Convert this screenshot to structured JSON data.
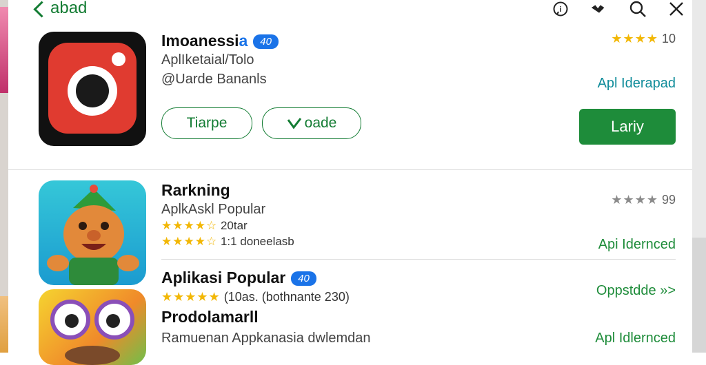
{
  "header": {
    "back_label": "abad"
  },
  "featured": {
    "title": "Imoanessi",
    "badge_prefix": "a",
    "badge": "40",
    "subtitle": "AplIketaial/Tolo",
    "developer": "@Uarde Bananls",
    "rating_stars": "★★★★",
    "rating_value": "10",
    "side_link": "Apl Iderapad",
    "button_1": "Tiarpe",
    "button_2": "oade",
    "button_2_icon": "check-icon",
    "install": "Lariy"
  },
  "ranking": {
    "title": "Rarkning",
    "subtitle": "AplkAskl Popular",
    "row1_stars": "★★★★☆",
    "row1_text": "20tar",
    "row2_stars": "★★★★☆",
    "row2_text": "1:1 doneelasb",
    "gray_stars": "★★★★",
    "gray_value": "99",
    "side_link": "Api Idernced"
  },
  "popular": {
    "title": "Aplikasi Popular",
    "badge": "40",
    "stars": "★★★★★",
    "meta": "(10as. (bothnante 230)",
    "side_link": "Oppstdde »>"
  },
  "third": {
    "title": "Prodolamarll",
    "subtitle": "Ramuenan Appkanasia dwlemdan",
    "side_link": "Apl Idlernced"
  },
  "colors": {
    "accent_green": "#1e8c3a",
    "badge_blue": "#1a73e8",
    "star": "#f2b705",
    "teal": "#0f8c9a"
  },
  "icons": [
    "back-icon",
    "info-icon",
    "heart-icon",
    "search-icon",
    "close-icon"
  ]
}
